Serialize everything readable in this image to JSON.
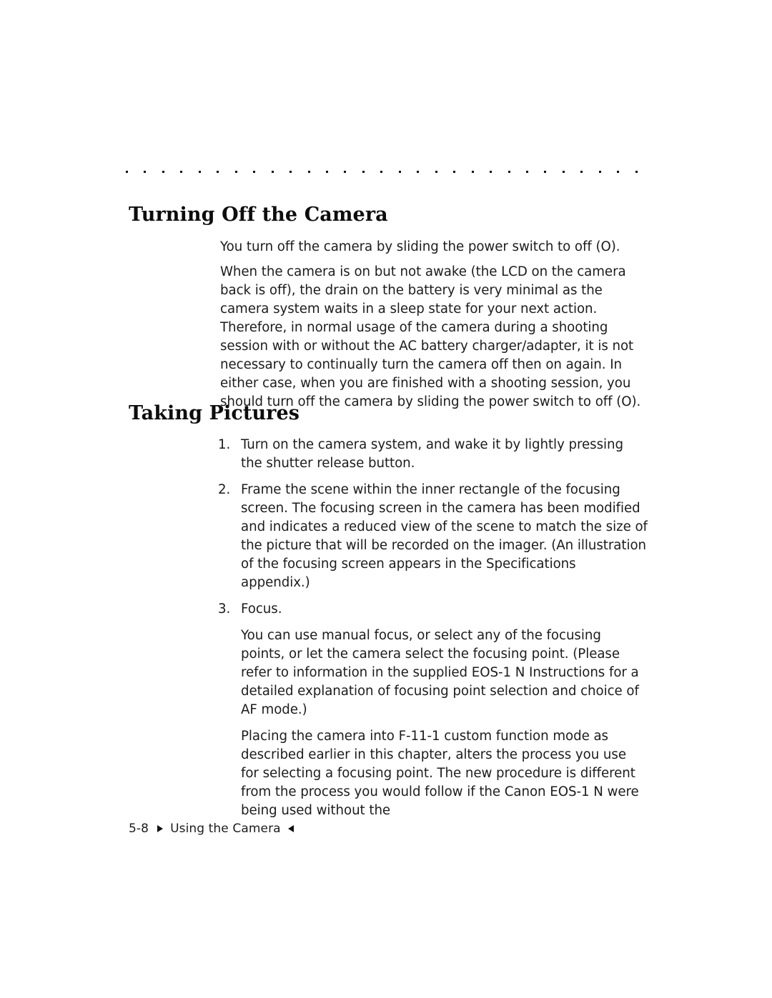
{
  "page": {
    "background": "#ffffff",
    "ink": "#1c1c1c",
    "rule_dot_count": 29
  },
  "sections": [
    {
      "heading": "Turning Off the Camera",
      "paragraphs": [
        "You turn off the camera by sliding the power switch to off (O).",
        "When the camera is on but not awake (the LCD on the camera back is off), the drain on the battery is very minimal as the camera system waits in a sleep state for your next action. Therefore, in normal usage of the camera during a shooting session with or without the AC battery charger/adapter, it is not necessary to continually turn the camera off then on again. In either case, when you are finished with a shooting session, you should turn off the camera by sliding the power switch to off (O)."
      ]
    },
    {
      "heading": "Taking Pictures",
      "steps": [
        {
          "number": "1.",
          "text": "Turn on the camera system, and wake it by lightly pressing the shutter release button."
        },
        {
          "number": "2.",
          "text": "Frame the scene within the inner rectangle of the focusing screen. The focusing screen in the camera has been modified and indicates a reduced view of the scene to match the size of the picture that will be recorded on the imager. (An illustration of the focusing screen appears in the Specifications appendix.)"
        },
        {
          "number": "3.",
          "text": "Focus."
        }
      ],
      "sub_paragraphs": [
        "You can use manual focus, or select any of the focusing points, or let the camera select the focusing point. (Please refer to information in the supplied EOS-1 N Instructions for a detailed explanation of focusing point selection and choice of AF mode.)",
        "Placing the camera into F-11-1 custom function mode as described earlier in this chapter, alters the process you use for selecting a focusing point. The new procedure is different from the process you would follow if the Canon EOS-1 N were being used without the"
      ]
    }
  ],
  "footer": {
    "page_number": "5-8",
    "label": "Using the Camera"
  }
}
